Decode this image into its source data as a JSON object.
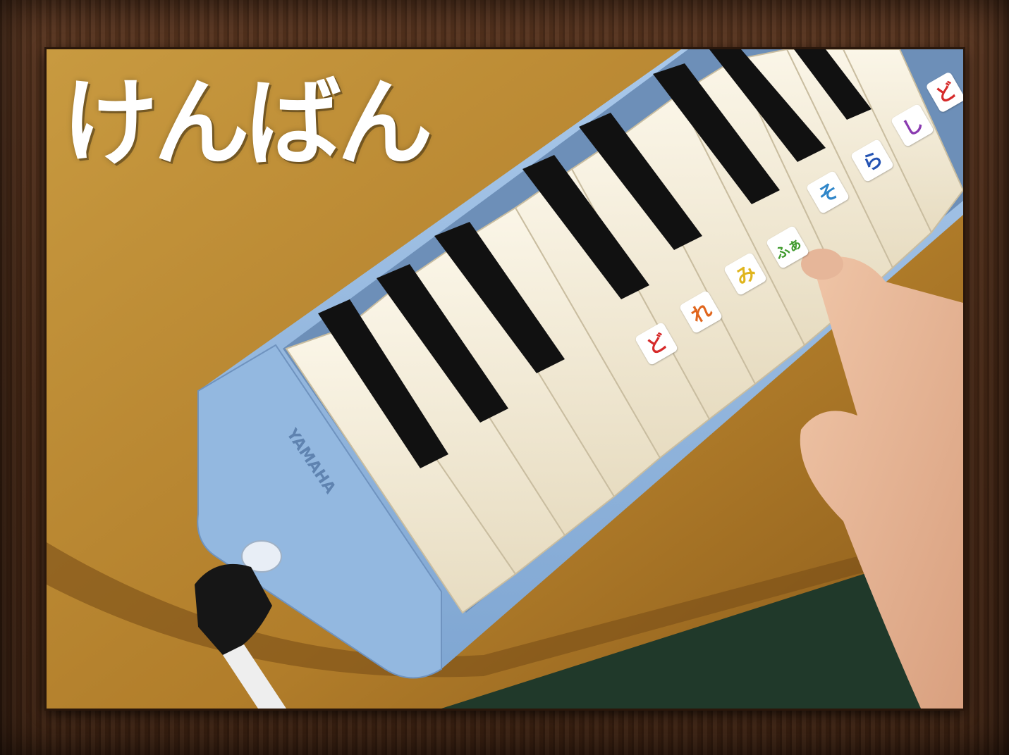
{
  "title": "けんばん",
  "brand": "YAMAHA",
  "note_stickers": [
    {
      "label": "ど",
      "color": "#d62a2a"
    },
    {
      "label": "れ",
      "color": "#e0661e"
    },
    {
      "label": "み",
      "color": "#e0b51e"
    },
    {
      "label": "ふぁ",
      "color": "#3f9a2c"
    },
    {
      "label": "そ",
      "color": "#2f86c9"
    },
    {
      "label": "ら",
      "color": "#2453b3"
    },
    {
      "label": "し",
      "color": "#8a3ab0"
    },
    {
      "label": "ど",
      "color": "#d62a2a"
    }
  ],
  "colors": {
    "table": "#b9852d",
    "melodica_body": "#8fb6e0",
    "white_key": "#f3ecd9",
    "black_key": "#111111",
    "frame_wood": "#4a2a17"
  }
}
